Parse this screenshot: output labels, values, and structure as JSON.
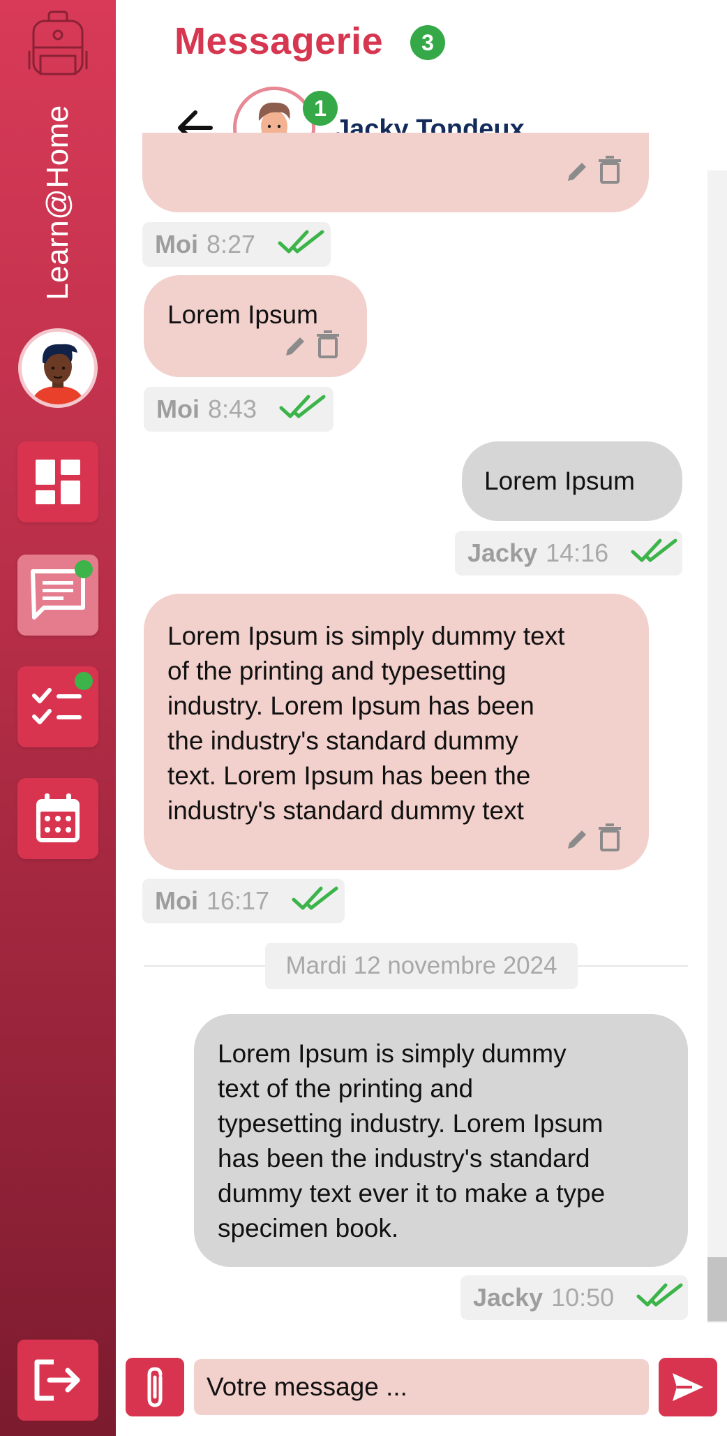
{
  "app": {
    "brand": "Learn@Home"
  },
  "header": {
    "title": "Messagerie",
    "unread_count": "3"
  },
  "contact": {
    "name": "Jacky Tondeux",
    "unread_count": "1"
  },
  "sidebar": {
    "items": [
      {
        "name": "dashboard",
        "icon": "dashboard-icon",
        "active": false,
        "notification": false
      },
      {
        "name": "messages",
        "icon": "chat-icon",
        "active": true,
        "notification": true
      },
      {
        "name": "tasks",
        "icon": "checklist-icon",
        "active": false,
        "notification": true
      },
      {
        "name": "calendar",
        "icon": "calendar-icon",
        "active": false,
        "notification": false
      }
    ],
    "logout_icon": "logout-icon"
  },
  "messages": [
    {
      "from": "me",
      "text": "",
      "sender": "Moi",
      "time": "8:27"
    },
    {
      "from": "me",
      "text": "Lorem Ipsum",
      "sender": "Moi",
      "time": "8:43"
    },
    {
      "from": "them",
      "text": "Lorem Ipsum",
      "sender": "Jacky",
      "time": "14:16"
    },
    {
      "from": "me",
      "text": "Lorem Ipsum is simply dummy text\nof the printing and  typesetting\nindustry. Lorem Ipsum has been\nthe industry's standard dummy\ntext. Lorem Ipsum has been the\nindustry's standard dummy text",
      "sender": "Moi",
      "time": "16:17"
    },
    {
      "from": "them",
      "text": "Lorem Ipsum is simply dummy\ntext of the printing and\ntypesetting industry. Lorem Ipsum\nhas been the industry's standard\ndummy text ever it to make a type\nspecimen book.",
      "sender": "Jacky",
      "time": "10:50"
    }
  ],
  "date_separator": "Mardi 12 novembre 2024",
  "composer": {
    "placeholder": "Votre message ..."
  },
  "colors": {
    "brand": "#d6364f",
    "sidebar_top": "#d83a57",
    "sidebar_bottom": "#7c1b2e",
    "my_bubble": "#f2d0cc",
    "their_bubble": "#d6d6d6",
    "badge_green": "#35a947",
    "read_check": "#3cb44a",
    "contact_name": "#132a5a"
  }
}
